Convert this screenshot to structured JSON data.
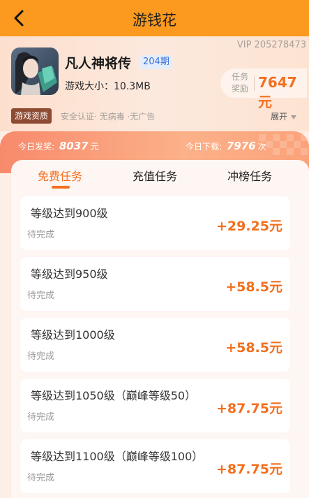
{
  "topbar": {
    "title": "游钱花",
    "back_icon": "back-chevron-icon"
  },
  "game": {
    "vip": "VIP 205278473",
    "name": "凡人神将传",
    "issue": "204期",
    "size": "游戏大小：10.3MB",
    "reward_label": "任务奖励",
    "reward_value": "7647元"
  },
  "qualification": {
    "tag": "游戏资质",
    "text": "安全认证· 无病毒 ·无广告",
    "expand_label": "展开"
  },
  "stats": {
    "today_reward_label": "今日发奖:",
    "today_reward_value": "8037",
    "today_reward_unit": "元",
    "today_download_label": "今日下载:",
    "today_download_value": "7976",
    "today_download_unit": "次"
  },
  "tabs": [
    {
      "label": "免费任务",
      "active": true
    },
    {
      "label": "充值任务",
      "active": false
    },
    {
      "label": "冲榜任务",
      "active": false
    }
  ],
  "tasks": [
    {
      "name": "等级达到900级",
      "status": "待完成",
      "reward": "+29.25元"
    },
    {
      "name": "等级达到950级",
      "status": "待完成",
      "reward": "+58.5元"
    },
    {
      "name": "等级达到1000级",
      "status": "待完成",
      "reward": "+58.5元"
    },
    {
      "name": "等级达到1050级（巅峰等级50）",
      "status": "待完成",
      "reward": "+87.75元"
    },
    {
      "name": "等级达到1100级（巅峰等级100）",
      "status": "待完成",
      "reward": "+87.75元"
    }
  ],
  "colors": {
    "topbar": "#fb9a1e",
    "accent": "#f2701f",
    "issue_blue": "#3b6fd6",
    "qual_tag": "#8e4a33"
  }
}
